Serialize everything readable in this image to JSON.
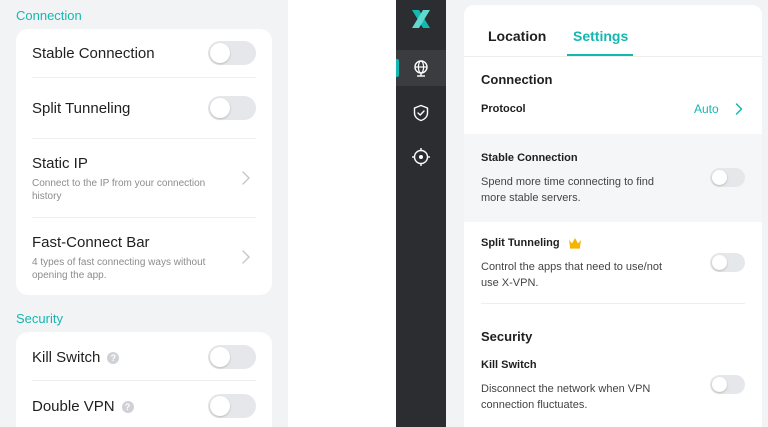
{
  "mobile": {
    "connection_header": "Connection",
    "security_header": "Security",
    "connection_items": [
      {
        "label": "Stable Connection",
        "type": "toggle",
        "on": false
      },
      {
        "label": "Split Tunneling",
        "type": "toggle",
        "on": false
      },
      {
        "label": "Static IP",
        "desc": "Connect to the IP from your connection history",
        "type": "link"
      },
      {
        "label": "Fast-Connect Bar",
        "desc": "4 types of fast connecting ways without opening the app.",
        "type": "link"
      }
    ],
    "security_items": [
      {
        "label": "Kill Switch",
        "help": "?",
        "type": "toggle",
        "on": false
      },
      {
        "label": "Double VPN",
        "help": "?",
        "type": "toggle",
        "on": false
      }
    ]
  },
  "desktop": {
    "sidebar": {
      "logo": "x-logo-icon",
      "nav": [
        {
          "icon": "globe-icon",
          "active": true
        },
        {
          "icon": "shield-check-icon",
          "active": false
        },
        {
          "icon": "crosshair-icon",
          "active": false
        }
      ]
    },
    "tabs": [
      {
        "label": "Location",
        "active": false
      },
      {
        "label": "Settings",
        "active": true
      }
    ],
    "connection_header": "Connection",
    "protocol": {
      "label": "Protocol",
      "value": "Auto"
    },
    "stable_connection": {
      "label": "Stable Connection",
      "desc": "Spend more time connecting to find more stable servers.",
      "on": false
    },
    "split_tunneling": {
      "label": "Split Tunneling",
      "badge": "crown-icon",
      "desc": "Control the apps that need to use/not use X-VPN.",
      "on": false
    },
    "security_header": "Security",
    "kill_switch": {
      "label": "Kill Switch",
      "desc": "Disconnect the network when VPN connection fluctuates.",
      "on": false
    }
  },
  "colors": {
    "accent": "#14b8b0",
    "sidebar_bg": "#2b2d30",
    "page_bg": "#f2f3f5",
    "crown": "#f5b400"
  }
}
